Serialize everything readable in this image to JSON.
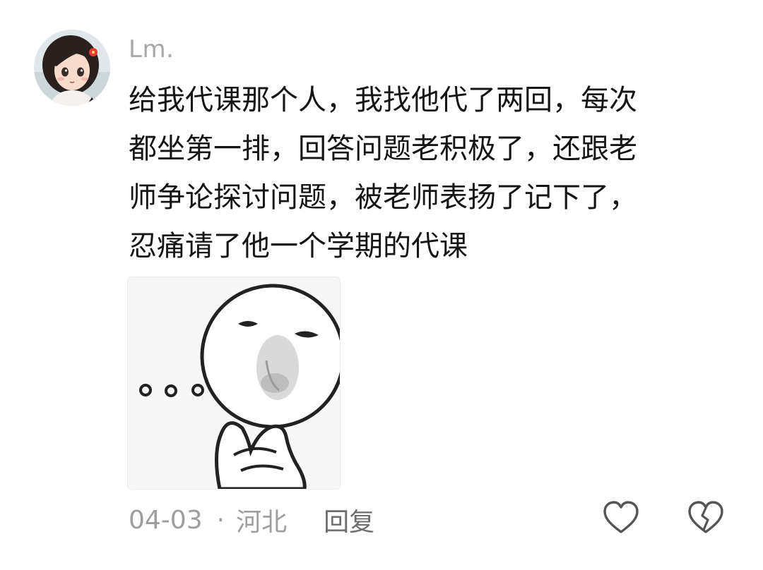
{
  "comment": {
    "username": "Lm.",
    "avatar_icon": "anime-girl-avatar",
    "text_lines": [
      "给我代课那个人，我找他代了两回，每次",
      "都坐第一排，回答问题老积极了，还跟老",
      "师争论探讨问题，被老师表扬了记下了，",
      "忍痛请了他一个学期的代课"
    ],
    "sticker_icon": "thinking-face-meme",
    "date": "04-03",
    "separator": "·",
    "location": "河北",
    "reply_label": "回复",
    "like_icon": "heart-outline-icon",
    "dislike_icon": "broken-heart-icon"
  },
  "colors": {
    "username": "#a8a8a8",
    "text": "#151515",
    "meta": "#9e9e9e",
    "reply": "#6e6e6e",
    "icon": "#555555"
  }
}
